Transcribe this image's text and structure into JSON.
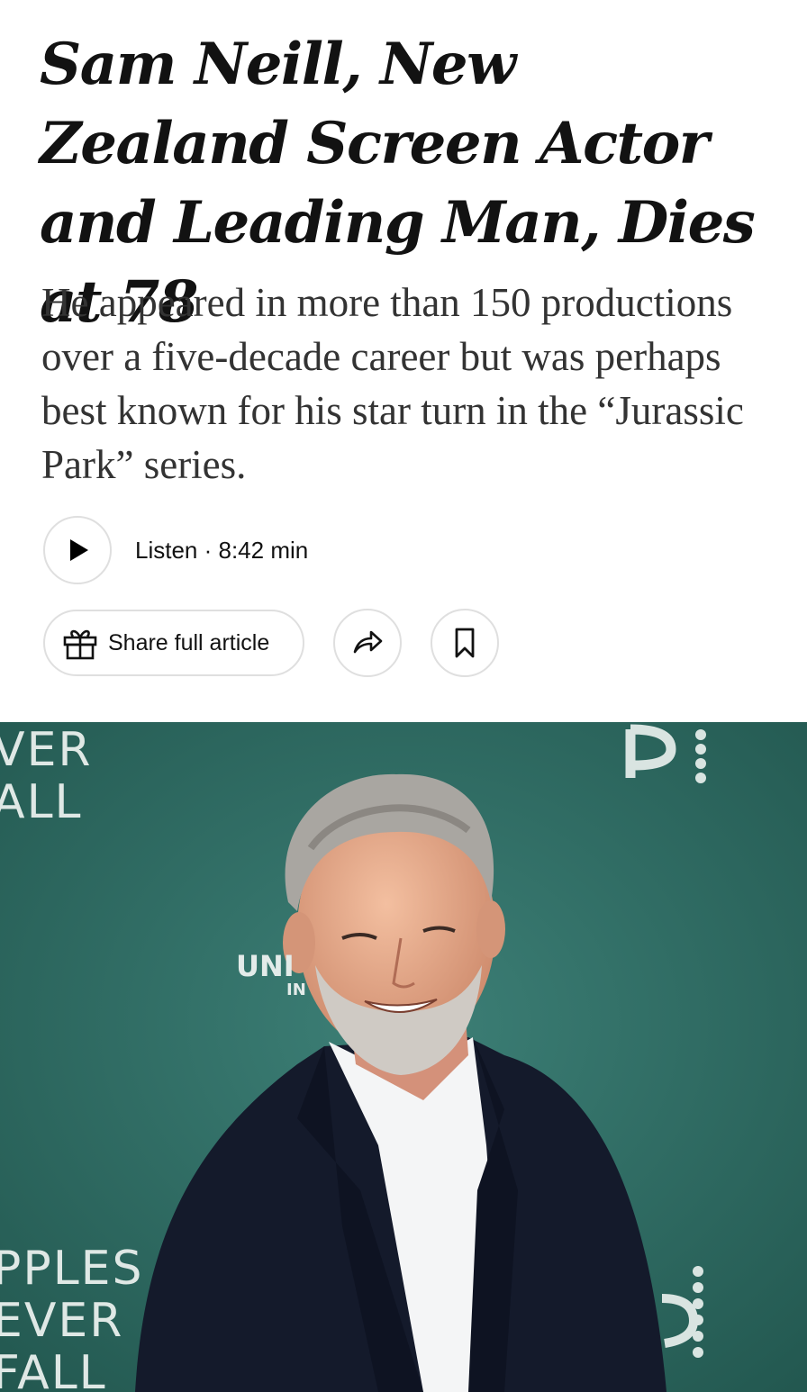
{
  "article": {
    "headline": "Sam Neill, New Zealand Screen Actor and Leading Man, Dies at 78",
    "summary": "He appeared in more than 150 productions over a five-decade career but was perhaps best known for his star turn in the “Jurassic Park” series."
  },
  "listen": {
    "label": "Listen · 8:42 min",
    "icon": "play-icon"
  },
  "share": {
    "full_article_label": "Share full article",
    "gift_icon": "gift-icon",
    "share_icon": "share-arrow-icon",
    "save_icon": "bookmark-icon"
  },
  "photo": {
    "backdrop_top_left": [
      "VER",
      "ALL"
    ],
    "backdrop_bottom_left": [
      "PPLES",
      "EVER",
      "FALL"
    ],
    "backdrop_logo": "UNI",
    "backdrop_logo_sub": "IN",
    "background_color": "#2e6b64"
  },
  "colors": {
    "text": "#121212",
    "summary_text": "#333333",
    "border": "#dfdfdf"
  }
}
